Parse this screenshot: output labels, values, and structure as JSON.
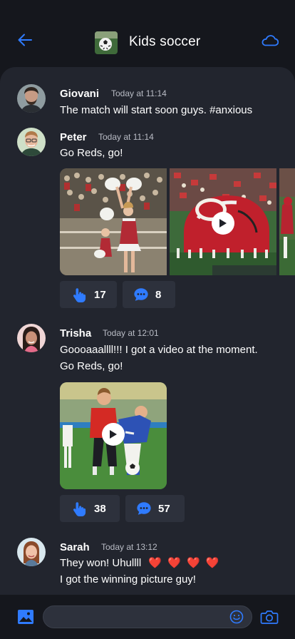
{
  "header": {
    "title": "Kids soccer"
  },
  "colors": {
    "accent": "#2f7bff",
    "panel": "#22252e",
    "background": "#15171d",
    "reaction_bg": "#2d313c",
    "heart": "#e8475a"
  },
  "messages": [
    {
      "sender": "Giovani",
      "time": "Today at 11:14",
      "text": "The match will start soon guys. #anxious"
    },
    {
      "sender": "Peter",
      "time": "Today at 11:14",
      "text": "Go Reds, go!",
      "reactions": {
        "likes": "17",
        "comments": "8"
      }
    },
    {
      "sender": "Trisha",
      "time": "Today at 12:01",
      "text_line1": "Goooaaallll!!! I got a video at the moment.",
      "text_line2": "Go Reds, go!",
      "reactions": {
        "likes": "38",
        "comments": "57"
      }
    },
    {
      "sender": "Sarah",
      "time": "Today at 13:12",
      "text_line1": "They won! Uhullll",
      "hearts": "❤️ ❤️ ❤️ ❤️",
      "text_line2": "I got the winning picture guy!"
    }
  ],
  "composer": {
    "value": "",
    "placeholder": ""
  },
  "icons": {
    "back": "arrow-left-icon",
    "cloud": "cloud-icon",
    "like": "hand-pointer-icon",
    "comment": "chat-bubble-icon",
    "image": "image-icon",
    "emoji": "smiley-icon",
    "camera": "camera-icon",
    "play": "play-icon"
  }
}
